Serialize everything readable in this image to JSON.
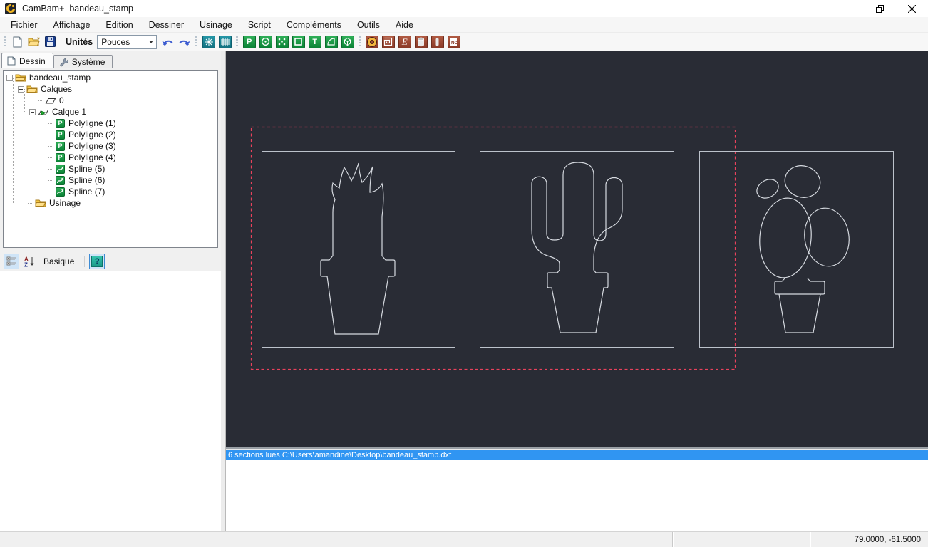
{
  "window": {
    "title": "CamBam+  bandeau_stamp"
  },
  "menu": {
    "items": [
      "Fichier",
      "Affichage",
      "Edition",
      "Dessiner",
      "Usinage",
      "Script",
      "Compléments",
      "Outils",
      "Aide"
    ]
  },
  "toolbar": {
    "units_label": "Unités",
    "units_value": "Pouces",
    "glyphs": {
      "polyline": "P",
      "text": "T",
      "engrave": "E",
      "nc": "NC"
    }
  },
  "tabs": {
    "drawing": "Dessin",
    "system": "Système"
  },
  "tree": {
    "items": [
      {
        "label": "bandeau_stamp"
      },
      {
        "label": "Calques"
      },
      {
        "label": "0"
      },
      {
        "label": "Calque 1"
      },
      {
        "label": "Polyligne (1)"
      },
      {
        "label": "Polyligne (2)"
      },
      {
        "label": "Polyligne (3)"
      },
      {
        "label": "Polyligne (4)"
      },
      {
        "label": "Spline (5)"
      },
      {
        "label": "Spline (6)"
      },
      {
        "label": "Spline (7)"
      },
      {
        "label": "Usinage"
      }
    ]
  },
  "props": {
    "view_label": "Basique",
    "help_glyph": "?",
    "sort_a": "A",
    "sort_z": "Z"
  },
  "log": {
    "message": "6 sections lues C:\\Users\\amandine\\Desktop\\bandeau_stamp.dxf"
  },
  "status": {
    "coordinates": "79.0000, -61.5000"
  },
  "icons": [
    "app-logo-icon",
    "minimize-icon",
    "restore-icon",
    "close-icon",
    "new-file-icon",
    "open-file-icon",
    "save-icon",
    "undo-icon",
    "redo-icon",
    "axes-icon",
    "grid-icon",
    "polyline-icon",
    "circle-icon",
    "points-icon",
    "rectangle-icon",
    "text-icon",
    "arc-icon",
    "surface-icon",
    "profile-toolpath-icon",
    "pocket-toolpath-icon",
    "engrave-toolpath-icon",
    "drill-toolpath-icon",
    "lathe-toolpath-icon",
    "nc-file-icon",
    "drawing-tab-icon",
    "wrench-icon",
    "folder-icon",
    "layer-icon",
    "active-layer-icon",
    "spline-icon",
    "categorized-view-icon",
    "az-sort-icon",
    "help-icon"
  ],
  "colors": {
    "canvas_bg": "#292c35",
    "geometry_line": "#d6dae0",
    "frame_line": "#bcc2cb",
    "selection_red": "#e8425c",
    "log_highlight": "#3095f2",
    "green_icon": "#0b8336",
    "maroon_icon": "#8a3a28",
    "teal_icon": "#137180"
  }
}
